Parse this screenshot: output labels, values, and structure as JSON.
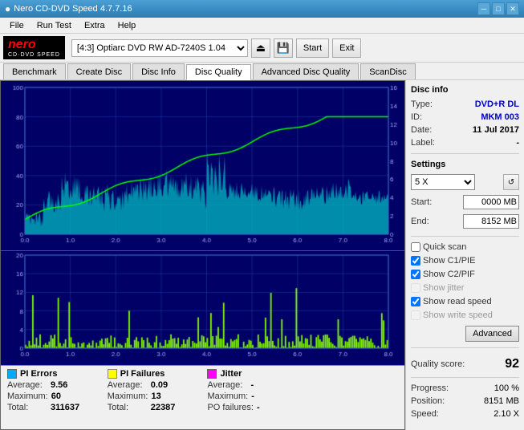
{
  "titlebar": {
    "title": "Nero CD-DVD Speed 4.7.7.16",
    "icon": "●",
    "min_label": "─",
    "max_label": "□",
    "close_label": "✕"
  },
  "menubar": {
    "items": [
      "File",
      "Run Test",
      "Extra",
      "Help"
    ]
  },
  "toolbar": {
    "drive_label": "[4:3]  Optiarc DVD RW AD-7240S 1.04",
    "start_label": "Start",
    "close_label": "Exit"
  },
  "tabs": {
    "items": [
      "Benchmark",
      "Create Disc",
      "Disc Info",
      "Disc Quality",
      "Advanced Disc Quality",
      "ScanDisc"
    ],
    "active": "Disc Quality"
  },
  "disc_info": {
    "section_title": "Disc info",
    "type_label": "Type:",
    "type_value": "DVD+R DL",
    "id_label": "ID:",
    "id_value": "MKM 003",
    "date_label": "Date:",
    "date_value": "11 Jul 2017",
    "label_label": "Label:",
    "label_value": "-"
  },
  "settings": {
    "section_title": "Settings",
    "speed_value": "5 X",
    "start_label": "Start:",
    "start_value": "0000 MB",
    "end_label": "End:",
    "end_value": "8152 MB"
  },
  "checkboxes": {
    "quick_scan": {
      "label": "Quick scan",
      "checked": false,
      "enabled": true
    },
    "show_c1_pie": {
      "label": "Show C1/PIE",
      "checked": true,
      "enabled": true
    },
    "show_c2_pif": {
      "label": "Show C2/PIF",
      "checked": true,
      "enabled": true
    },
    "show_jitter": {
      "label": "Show jitter",
      "checked": false,
      "enabled": false
    },
    "show_read_speed": {
      "label": "Show read speed",
      "checked": true,
      "enabled": true
    },
    "show_write_speed": {
      "label": "Show write speed",
      "checked": false,
      "enabled": false
    }
  },
  "advanced_btn": {
    "label": "Advanced"
  },
  "quality": {
    "label": "Quality score:",
    "value": "92"
  },
  "progress": {
    "progress_label": "Progress:",
    "progress_value": "100 %",
    "position_label": "Position:",
    "position_value": "8151 MB",
    "speed_label": "Speed:",
    "speed_value": "2.10 X"
  },
  "legend": {
    "pi_errors": {
      "title": "PI Errors",
      "color": "#00aaff",
      "avg_label": "Average:",
      "avg_value": "9.56",
      "max_label": "Maximum:",
      "max_value": "60",
      "total_label": "Total:",
      "total_value": "311637"
    },
    "pi_failures": {
      "title": "PI Failures",
      "color": "#ffff00",
      "avg_label": "Average:",
      "avg_value": "0.09",
      "max_label": "Maximum:",
      "max_value": "13",
      "total_label": "Total:",
      "total_value": "22387"
    },
    "jitter": {
      "title": "Jitter",
      "color": "#ff00ff",
      "avg_label": "Average:",
      "avg_value": "-",
      "max_label": "Maximum:",
      "max_value": "-"
    },
    "po_failures": {
      "label": "PO failures:",
      "value": "-"
    }
  }
}
